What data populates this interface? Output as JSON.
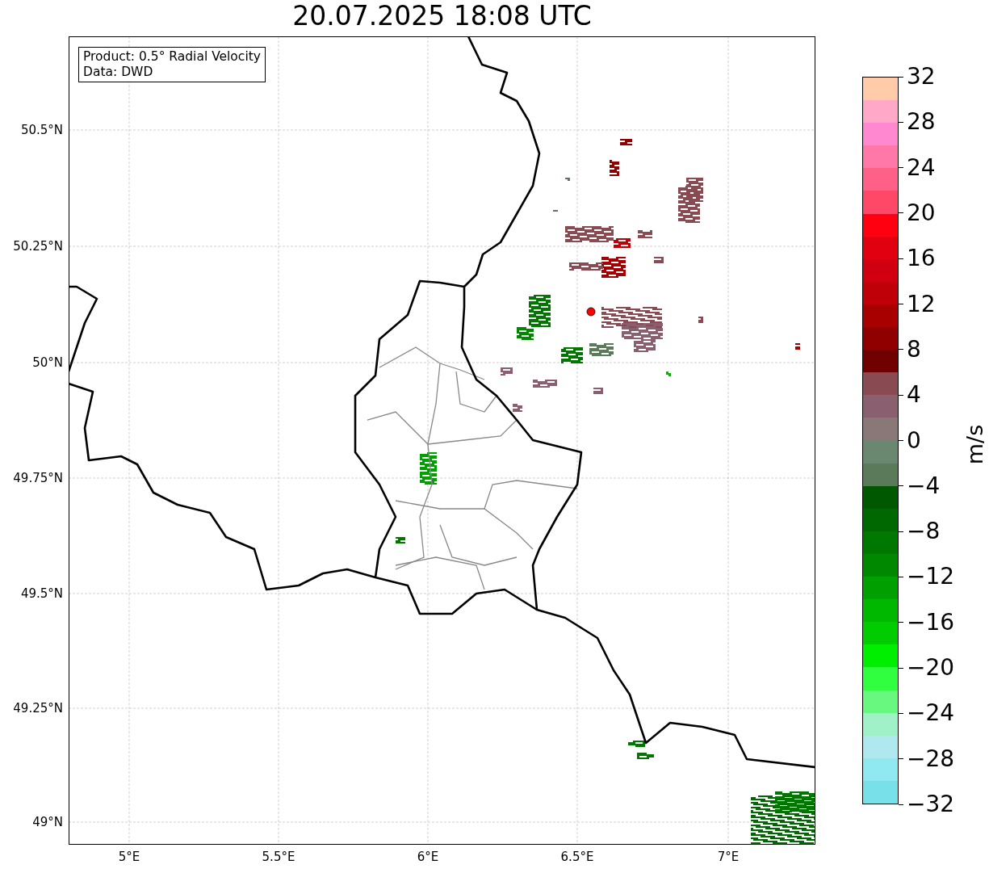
{
  "title": "20.07.2025 18:08 UTC",
  "info_box": {
    "lines": [
      "Product: 0.5° Radial Velocity",
      "Data: DWD"
    ]
  },
  "map": {
    "lat_labels": [
      "50.5°N",
      "50.25°N",
      "50°N",
      "49.75°N",
      "49.5°N",
      "49.25°N",
      "49°N"
    ],
    "lon_labels": [
      "5°E",
      "5.5°E",
      "6°E",
      "6.5°E",
      "7°E"
    ]
  },
  "colorbar": {
    "label": "m/s",
    "ticks": [
      "32",
      "28",
      "24",
      "20",
      "16",
      "12",
      "8",
      "4",
      "0",
      "−4",
      "−8",
      "−12",
      "−16",
      "−20",
      "−24",
      "−28",
      "−32"
    ],
    "segments": [
      {
        "color": "#ffcba8"
      },
      {
        "color": "#ffa8c8"
      },
      {
        "color": "#ff88d0"
      },
      {
        "color": "#ff78a8"
      },
      {
        "color": "#ff6088"
      },
      {
        "color": "#ff4868"
      },
      {
        "color": "#ff0010"
      },
      {
        "color": "#e00010"
      },
      {
        "color": "#d00010"
      },
      {
        "color": "#c00008"
      },
      {
        "color": "#a80000"
      },
      {
        "color": "#900000"
      },
      {
        "color": "#700000"
      },
      {
        "color": "#8a4a52"
      },
      {
        "color": "#8a6070"
      },
      {
        "color": "#8a7878"
      },
      {
        "color": "#6a8870"
      },
      {
        "color": "#5a7a5a"
      },
      {
        "color": "#005800"
      },
      {
        "color": "#006800"
      },
      {
        "color": "#007800"
      },
      {
        "color": "#008800"
      },
      {
        "color": "#00a000"
      },
      {
        "color": "#00b800"
      },
      {
        "color": "#00cc00"
      },
      {
        "color": "#00ee00"
      },
      {
        "color": "#30ff40"
      },
      {
        "color": "#68f880"
      },
      {
        "color": "#a0f0c8"
      },
      {
        "color": "#b0e8f0"
      },
      {
        "color": "#90e8f0"
      },
      {
        "color": "#78e0e8"
      }
    ]
  }
}
